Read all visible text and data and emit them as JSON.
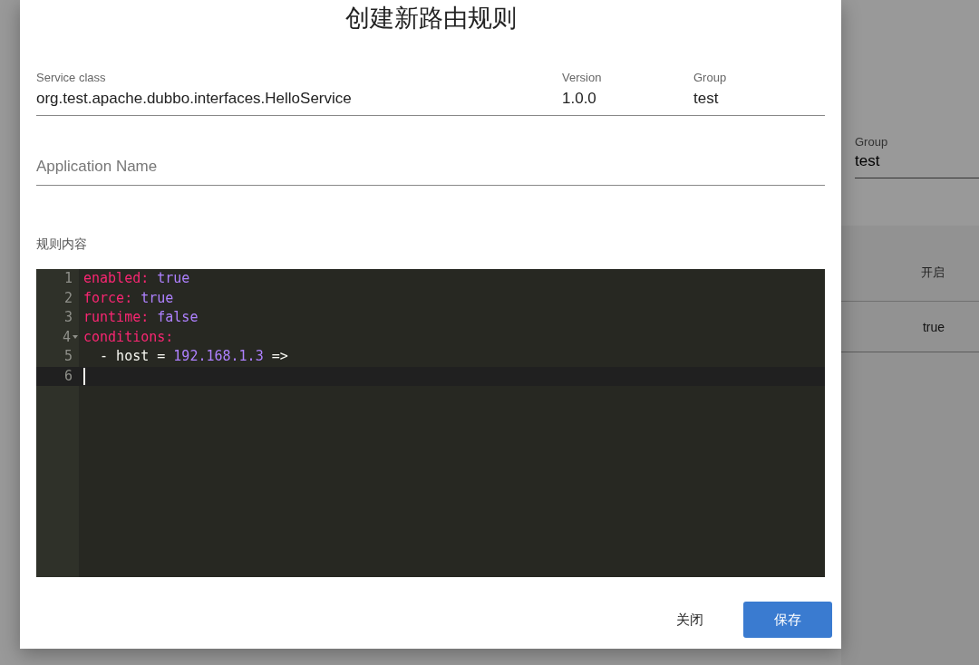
{
  "background": {
    "group_field": {
      "label": "Group",
      "value": "test"
    },
    "table": {
      "header": "开启",
      "rows": [
        "true"
      ]
    }
  },
  "dialog": {
    "title": "创建新路由规则",
    "fields": [
      {
        "label": "Service class",
        "value": "org.test.apache.dubbo.interfaces.HelloService"
      },
      {
        "label": "Version",
        "value": "1.0.0"
      },
      {
        "label": "Group",
        "value": "test"
      }
    ],
    "application_name": {
      "placeholder": "Application Name"
    },
    "rule_label": "规则内容",
    "editor": {
      "lines": [
        {
          "number": "1",
          "foldable": false,
          "active": false,
          "tokens": [
            {
              "kind": "key",
              "text": "enabled:"
            },
            {
              "kind": "value",
              "text": " true"
            }
          ]
        },
        {
          "number": "2",
          "foldable": false,
          "active": false,
          "tokens": [
            {
              "kind": "key",
              "text": "force:"
            },
            {
              "kind": "value",
              "text": " true"
            }
          ]
        },
        {
          "number": "3",
          "foldable": false,
          "active": false,
          "tokens": [
            {
              "kind": "key",
              "text": "runtime:"
            },
            {
              "kind": "value",
              "text": " false"
            }
          ]
        },
        {
          "number": "4",
          "foldable": true,
          "active": false,
          "tokens": [
            {
              "kind": "key",
              "text": "conditions:"
            }
          ]
        },
        {
          "number": "5",
          "foldable": false,
          "active": false,
          "tokens": [
            {
              "kind": "plain",
              "text": "  - host = "
            },
            {
              "kind": "value",
              "text": "192.168.1.3"
            },
            {
              "kind": "plain",
              "text": " =>"
            }
          ]
        },
        {
          "number": "6",
          "foldable": false,
          "active": true
        }
      ]
    },
    "buttons": [
      {
        "kind": "text",
        "label": "关闭"
      },
      {
        "kind": "primary",
        "label": "保存"
      }
    ]
  }
}
